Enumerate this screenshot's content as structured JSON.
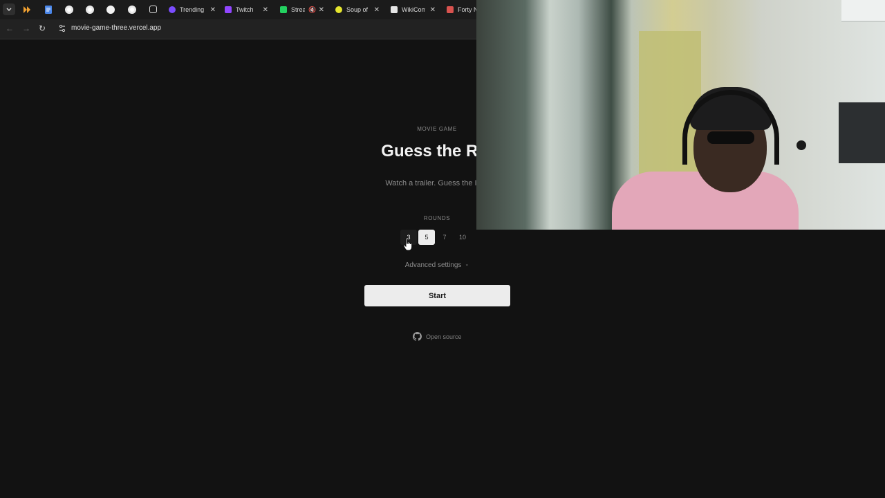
{
  "browser": {
    "tabs": [
      {
        "label": "Trending",
        "fav_color": "#7b4dff",
        "closable": true
      },
      {
        "label": "Twitch",
        "fav_color": "#9146ff",
        "closable": true
      },
      {
        "label": "Strea",
        "fav_color": "#23d160",
        "closable": true
      },
      {
        "label": "Soup of",
        "fav_color": "#e6e62e",
        "closable": true
      },
      {
        "label": "WikiCom",
        "fav_color": "#e6e6e6",
        "closable": true
      },
      {
        "label": "Forty Ni",
        "fav_color": "#d9534f",
        "closable": false
      }
    ],
    "pinned_icons": [
      "google-docs-icon",
      "chrome-icon",
      "chrome-icon",
      "github-icon",
      "chrome-icon",
      "instagram-icon"
    ],
    "close_glyph": "✕",
    "url": "movie-game-three.vercel.app"
  },
  "page": {
    "eyebrow": "MOVIE GAME",
    "title": "Guess the Rat",
    "subtitle": "Watch a trailer. Guess the IMD",
    "rounds_label": "ROUNDS",
    "rounds": [
      {
        "label": "3",
        "state": "hover"
      },
      {
        "label": "5",
        "state": "selected"
      },
      {
        "label": "7",
        "state": "normal"
      },
      {
        "label": "10",
        "state": "normal"
      }
    ],
    "advanced_label": "Advanced settings",
    "advanced_caret": "⌄",
    "start_label": "Start",
    "open_source_label": "Open source"
  }
}
